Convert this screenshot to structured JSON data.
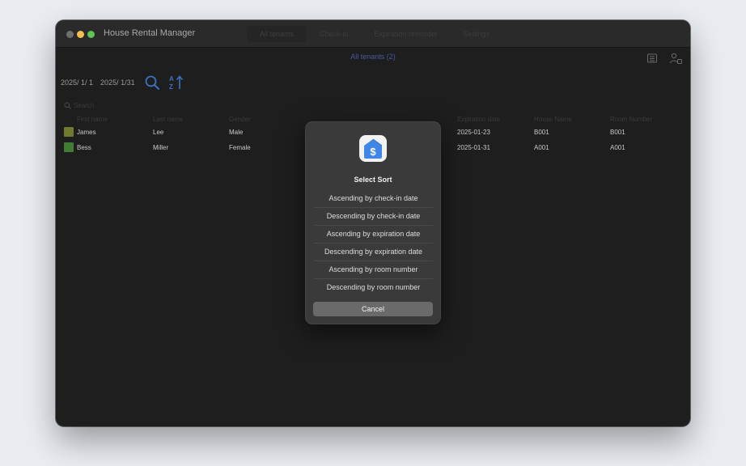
{
  "window": {
    "title": "House Rental Manager",
    "tabs": [
      {
        "label": "All tenants",
        "active": true
      },
      {
        "label": "Check-in",
        "active": false
      },
      {
        "label": "Expiration reminder",
        "active": false
      },
      {
        "label": "Settings",
        "active": false
      }
    ]
  },
  "header": {
    "subtitle": "All tenants (2)",
    "icons": [
      "list-icon",
      "add-user-icon"
    ]
  },
  "filters": {
    "start_date": "2025/  1/  1",
    "end_date": "2025/  1/31",
    "search_icon": "search-icon",
    "sort_icon": "sort-az-icon"
  },
  "search": {
    "placeholder": "Search"
  },
  "table": {
    "columns": [
      "First name",
      "Last name",
      "Gender",
      "",
      "",
      "Expiration date",
      "House Name",
      "Room Number"
    ],
    "rows": [
      {
        "color": "#6f7a2e",
        "first": "James",
        "last": "Lee",
        "gender": "Male",
        "expiration": "2025-01-23",
        "house": "B001",
        "room": "B001"
      },
      {
        "color": "#3f7d33",
        "first": "Bess",
        "last": "Miller",
        "gender": "Female",
        "expiration": "2025-01-31",
        "house": "A001",
        "room": "A001"
      }
    ]
  },
  "dialog": {
    "icon": "house-dollar-icon",
    "title": "Select Sort",
    "options": [
      "Ascending by check-in date",
      "Descending by check-in date",
      "Ascending by expiration date",
      "Descending by expiration date",
      "Ascending by room number",
      "Descending by room number"
    ],
    "cancel_label": "Cancel"
  },
  "colors": {
    "accent": "#3a72c4",
    "subtitle": "#4a58a0",
    "traffic_close": "#6f6f6f",
    "traffic_min": "#f4bf4f",
    "traffic_max": "#5fc453"
  }
}
